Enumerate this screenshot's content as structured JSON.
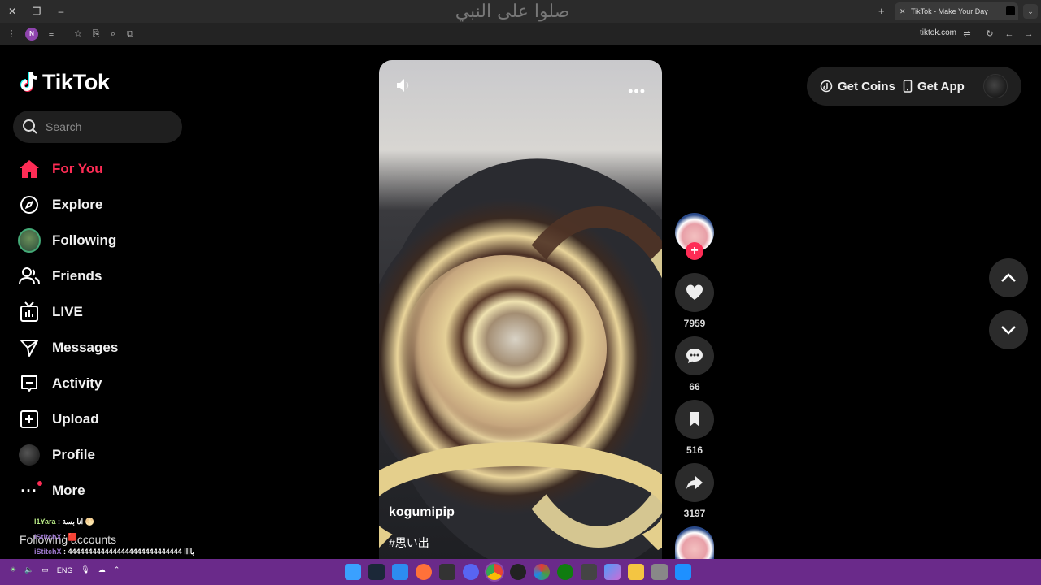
{
  "browser": {
    "window_title": "صلوا على النبي",
    "tab_title": "TikTok - Make Your Day",
    "url": "tiktok.com",
    "profile_initial": "N"
  },
  "sidebar": {
    "logo_text": "TikTok",
    "search_placeholder": "Search",
    "nav": [
      {
        "label": "For You",
        "icon": "home-icon",
        "active": true
      },
      {
        "label": "Explore",
        "icon": "compass-icon"
      },
      {
        "label": "Following",
        "icon": "following-avatar"
      },
      {
        "label": "Friends",
        "icon": "friends-icon"
      },
      {
        "label": "LIVE",
        "icon": "live-tv-icon"
      },
      {
        "label": "Messages",
        "icon": "send-icon"
      },
      {
        "label": "Activity",
        "icon": "activity-icon"
      },
      {
        "label": "Upload",
        "icon": "plus-square-icon"
      },
      {
        "label": "Profile",
        "icon": "profile-avatar"
      },
      {
        "label": "More",
        "icon": "more-dots-icon"
      }
    ],
    "following_accounts_label": "Following accounts"
  },
  "chat_overlay": [
    {
      "user": "l1Yara",
      "text": "انا بسة",
      "color": "#b8e986"
    },
    {
      "user": "iStitchX",
      "text": "",
      "color": "#a07bd0"
    },
    {
      "user": "iStitchX",
      "text": "باااا 4444444444444444444444444444",
      "color": "#a07bd0"
    }
  ],
  "video": {
    "author": "kogumipip",
    "caption": "#思い出"
  },
  "actions": {
    "likes": "7959",
    "comments": "66",
    "saves": "516",
    "shares": "3197"
  },
  "header": {
    "get_coins": "Get Coins",
    "get_app": "Get App"
  },
  "taskbar": {
    "language": "ENG"
  },
  "colors": {
    "accent": "#fe2c55",
    "taskbar": "#6a2a8a"
  }
}
